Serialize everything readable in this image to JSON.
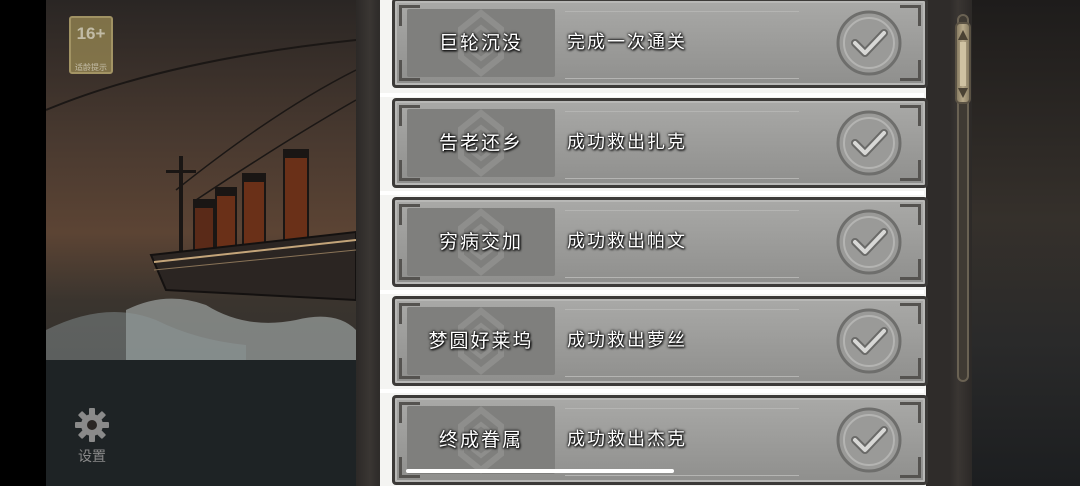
{
  "age_rating": {
    "number": "16+",
    "caption": "适龄提示"
  },
  "settings": {
    "label": "设置",
    "icon": "gear-icon"
  },
  "achievements": [
    {
      "title": "巨轮沉没",
      "description": "完成一次通关",
      "status_icon": "checkmark-icon"
    },
    {
      "title": "告老还乡",
      "description": "成功救出扎克",
      "status_icon": "checkmark-icon"
    },
    {
      "title": "穷病交加",
      "description": "成功救出帕文",
      "status_icon": "checkmark-icon"
    },
    {
      "title": "梦圆好莱坞",
      "description": "成功救出萝丝",
      "status_icon": "checkmark-icon"
    },
    {
      "title": "终成眷属",
      "description": "成功救出杰克",
      "status_icon": "checkmark-icon"
    }
  ],
  "colors": {
    "card": "#9c9c9a",
    "card_border": "#3c3a38",
    "panel": "#2f2c2a",
    "text": "#ffffff"
  }
}
